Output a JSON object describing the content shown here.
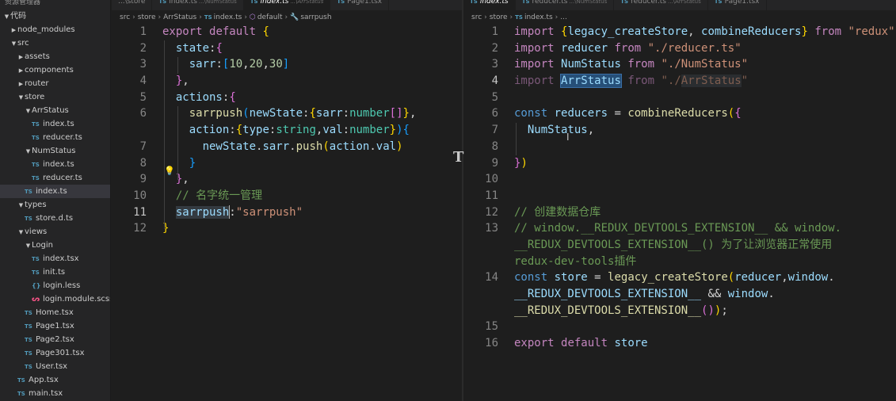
{
  "sidebar": {
    "header": "资源管理器",
    "tree": [
      {
        "label": "代码",
        "depth": 0,
        "kind": "folder-open"
      },
      {
        "label": "node_modules",
        "depth": 1,
        "kind": "folder"
      },
      {
        "label": "src",
        "depth": 1,
        "kind": "folder-open"
      },
      {
        "label": "assets",
        "depth": 2,
        "kind": "folder"
      },
      {
        "label": "components",
        "depth": 2,
        "kind": "folder"
      },
      {
        "label": "router",
        "depth": 2,
        "kind": "folder"
      },
      {
        "label": "store",
        "depth": 2,
        "kind": "folder-open"
      },
      {
        "label": "ArrStatus",
        "depth": 3,
        "kind": "folder-open"
      },
      {
        "label": "index.ts",
        "depth": 4,
        "kind": "ts"
      },
      {
        "label": "reducer.ts",
        "depth": 4,
        "kind": "ts"
      },
      {
        "label": "NumStatus",
        "depth": 3,
        "kind": "folder-open"
      },
      {
        "label": "index.ts",
        "depth": 4,
        "kind": "ts"
      },
      {
        "label": "reducer.ts",
        "depth": 4,
        "kind": "ts"
      },
      {
        "label": "index.ts",
        "depth": 3,
        "kind": "ts",
        "selected": true
      },
      {
        "label": "types",
        "depth": 2,
        "kind": "folder-open"
      },
      {
        "label": "store.d.ts",
        "depth": 3,
        "kind": "dts"
      },
      {
        "label": "views",
        "depth": 2,
        "kind": "folder-open"
      },
      {
        "label": "Login",
        "depth": 3,
        "kind": "folder-open"
      },
      {
        "label": "index.tsx",
        "depth": 4,
        "kind": "tsx"
      },
      {
        "label": "init.ts",
        "depth": 4,
        "kind": "ts"
      },
      {
        "label": "login.less",
        "depth": 4,
        "kind": "less"
      },
      {
        "label": "login.module.scss",
        "depth": 4,
        "kind": "scss"
      },
      {
        "label": "Home.tsx",
        "depth": 3,
        "kind": "tsx"
      },
      {
        "label": "Page1.tsx",
        "depth": 3,
        "kind": "tsx"
      },
      {
        "label": "Page2.tsx",
        "depth": 3,
        "kind": "tsx"
      },
      {
        "label": "Page301.tsx",
        "depth": 3,
        "kind": "tsx"
      },
      {
        "label": "User.tsx",
        "depth": 3,
        "kind": "tsx"
      },
      {
        "label": "App.tsx",
        "depth": 2,
        "kind": "tsx"
      },
      {
        "label": "main.tsx",
        "depth": 2,
        "kind": "tsx"
      }
    ]
  },
  "left_editor": {
    "tabs": [
      {
        "label": "...\\store",
        "desc": ""
      },
      {
        "label": "index.ts",
        "desc": "...\\NumStatus"
      },
      {
        "label": "index.ts",
        "desc": "...\\ArrStatus",
        "active": true
      },
      {
        "label": "Page1.tsx",
        "desc": ""
      }
    ],
    "breadcrumb": [
      "src",
      "store",
      "ArrStatus",
      "index.ts",
      "default",
      "sarrpush"
    ],
    "lines": [
      {
        "n": "1",
        "tokens": [
          [
            "kw",
            "export"
          ],
          [
            "pun",
            " "
          ],
          [
            "kw",
            "default"
          ],
          [
            "pun",
            " "
          ],
          [
            "b1",
            "{"
          ]
        ]
      },
      {
        "n": "2",
        "tokens": [
          [
            "pun",
            "  "
          ],
          [
            "var",
            "state"
          ],
          [
            "pun",
            ":"
          ],
          [
            "b2",
            "{"
          ]
        ]
      },
      {
        "n": "3",
        "tokens": [
          [
            "pun",
            "    "
          ],
          [
            "var",
            "sarr"
          ],
          [
            "pun",
            ":"
          ],
          [
            "b3",
            "["
          ],
          [
            "num",
            "10"
          ],
          [
            "pun",
            ","
          ],
          [
            "num",
            "20"
          ],
          [
            "pun",
            ","
          ],
          [
            "num",
            "30"
          ],
          [
            "b3",
            "]"
          ]
        ]
      },
      {
        "n": "4",
        "tokens": [
          [
            "pun",
            "  "
          ],
          [
            "b2",
            "}"
          ],
          [
            "pun",
            ","
          ]
        ]
      },
      {
        "n": "5",
        "tokens": [
          [
            "pun",
            "  "
          ],
          [
            "var",
            "actions"
          ],
          [
            "pun",
            ":"
          ],
          [
            "b2",
            "{"
          ]
        ]
      },
      {
        "n": "6",
        "tokens": [
          [
            "pun",
            "    "
          ],
          [
            "fn",
            "sarrpush"
          ],
          [
            "b3",
            "("
          ],
          [
            "var",
            "newState"
          ],
          [
            "pun",
            ":"
          ],
          [
            "b1",
            "{"
          ],
          [
            "var",
            "sarr"
          ],
          [
            "pun",
            ":"
          ],
          [
            "type",
            "number"
          ],
          [
            "b2",
            "[]"
          ],
          [
            "b1",
            "}"
          ],
          [
            "pun",
            ","
          ]
        ]
      },
      {
        "n": "",
        "tokens": [
          [
            "pun",
            "    "
          ],
          [
            "var",
            "action"
          ],
          [
            "pun",
            ":"
          ],
          [
            "b1",
            "{"
          ],
          [
            "var",
            "type"
          ],
          [
            "pun",
            ":"
          ],
          [
            "type",
            "string"
          ],
          [
            "pun",
            ","
          ],
          [
            "var",
            "val"
          ],
          [
            "pun",
            ":"
          ],
          [
            "type",
            "number"
          ],
          [
            "b1",
            "}"
          ],
          [
            "b3",
            ")"
          ],
          [
            "b3",
            "{"
          ]
        ]
      },
      {
        "n": "7",
        "tokens": [
          [
            "pun",
            "      "
          ],
          [
            "var",
            "newState"
          ],
          [
            "pun",
            "."
          ],
          [
            "var",
            "sarr"
          ],
          [
            "pun",
            "."
          ],
          [
            "fn",
            "push"
          ],
          [
            "b1",
            "("
          ],
          [
            "var",
            "action"
          ],
          [
            "pun",
            "."
          ],
          [
            "var",
            "val"
          ],
          [
            "b1",
            ")"
          ]
        ]
      },
      {
        "n": "8",
        "tokens": [
          [
            "pun",
            "    "
          ],
          [
            "b3",
            "}"
          ]
        ]
      },
      {
        "n": "9",
        "tokens": [
          [
            "pun",
            "  "
          ],
          [
            "b2",
            "}"
          ],
          [
            "pun",
            ","
          ]
        ]
      },
      {
        "n": "10",
        "tokens": [
          [
            "pun",
            "  "
          ],
          [
            "cmt",
            "// 名字统一管理"
          ]
        ]
      },
      {
        "n": "11",
        "current": true,
        "tokens": [
          [
            "pun",
            "  "
          ],
          [
            "var hl2",
            "sarrpush"
          ],
          [
            "pun",
            ":"
          ],
          [
            "str",
            "\"sarrpush\""
          ]
        ]
      },
      {
        "n": "12",
        "tokens": [
          [
            "b1",
            "}"
          ]
        ]
      }
    ]
  },
  "right_editor": {
    "tabs": [
      {
        "label": "index.ts",
        "desc": "",
        "active": true
      },
      {
        "label": "reducer.ts",
        "desc": "...\\NumStatus"
      },
      {
        "label": "reducer.ts",
        "desc": "...\\ArrStatus"
      },
      {
        "label": "Page1.tsx",
        "desc": ""
      }
    ],
    "breadcrumb": [
      "src",
      "store",
      "index.ts",
      "..."
    ],
    "lines": [
      {
        "n": "1",
        "tokens": [
          [
            "kw",
            "import"
          ],
          [
            "pun",
            " "
          ],
          [
            "b1",
            "{"
          ],
          [
            "var",
            "legacy_createStore"
          ],
          [
            "pun",
            ", "
          ],
          [
            "var",
            "combineReducers"
          ],
          [
            "b1",
            "}"
          ],
          [
            "pun",
            " "
          ],
          [
            "kw",
            "from"
          ],
          [
            "pun",
            " "
          ],
          [
            "str",
            "\"redux\""
          ]
        ]
      },
      {
        "n": "2",
        "tokens": [
          [
            "kw",
            "import"
          ],
          [
            "pun",
            " "
          ],
          [
            "var",
            "reducer"
          ],
          [
            "pun",
            " "
          ],
          [
            "kw",
            "from"
          ],
          [
            "pun",
            " "
          ],
          [
            "str",
            "\"./reducer.ts\""
          ]
        ]
      },
      {
        "n": "3",
        "tokens": [
          [
            "kw",
            "import"
          ],
          [
            "pun",
            " "
          ],
          [
            "var",
            "NumStatus"
          ],
          [
            "pun",
            " "
          ],
          [
            "kw",
            "from"
          ],
          [
            "pun",
            " "
          ],
          [
            "str",
            "\"./NumStatus\""
          ]
        ]
      },
      {
        "n": "4",
        "current": true,
        "tokens": [
          [
            "kw dim",
            "import"
          ],
          [
            "pun",
            " "
          ],
          [
            "var hlsel",
            "ArrStatus"
          ],
          [
            "pun",
            " "
          ],
          [
            "kw dim",
            "from"
          ],
          [
            "pun",
            " "
          ],
          [
            "str dim",
            "\"./"
          ],
          [
            "str dim hl2",
            "ArrStatus"
          ],
          [
            "str dim",
            "\""
          ]
        ]
      },
      {
        "n": "5",
        "tokens": []
      },
      {
        "n": "6",
        "tokens": [
          [
            "kw2",
            "const"
          ],
          [
            "pun",
            " "
          ],
          [
            "var",
            "reducers"
          ],
          [
            "pun",
            " = "
          ],
          [
            "fn",
            "combineReducers"
          ],
          [
            "b1",
            "("
          ],
          [
            "b2",
            "{"
          ]
        ]
      },
      {
        "n": "7",
        "tokens": [
          [
            "pun",
            "  "
          ],
          [
            "var",
            "NumStatus"
          ],
          [
            "pun",
            ","
          ]
        ]
      },
      {
        "n": "8",
        "tokens": []
      },
      {
        "n": "9",
        "tokens": [
          [
            "b2",
            "}"
          ],
          [
            "b1",
            ")"
          ]
        ]
      },
      {
        "n": "10",
        "tokens": []
      },
      {
        "n": "11",
        "tokens": []
      },
      {
        "n": "12",
        "tokens": [
          [
            "cmt",
            "// 创建数据仓库"
          ]
        ]
      },
      {
        "n": "13",
        "tokens": [
          [
            "cmt",
            "// window.__REDUX_DEVTOOLS_EXTENSION__ && window."
          ]
        ]
      },
      {
        "n": "",
        "tokens": [
          [
            "cmt",
            "__REDUX_DEVTOOLS_EXTENSION__() 为了让浏览器正常使用"
          ]
        ]
      },
      {
        "n": "",
        "tokens": [
          [
            "cmt",
            "redux-dev-tools插件"
          ]
        ]
      },
      {
        "n": "14",
        "tokens": [
          [
            "kw2",
            "const"
          ],
          [
            "pun",
            " "
          ],
          [
            "var",
            "store"
          ],
          [
            "pun",
            " = "
          ],
          [
            "fn",
            "legacy_createStore"
          ],
          [
            "b1",
            "("
          ],
          [
            "var",
            "reducer"
          ],
          [
            "pun",
            ","
          ],
          [
            "var",
            "window"
          ],
          [
            "pun",
            "."
          ]
        ]
      },
      {
        "n": "",
        "tokens": [
          [
            "var",
            "__REDUX_DEVTOOLS_EXTENSION__"
          ],
          [
            "pun",
            " && "
          ],
          [
            "var",
            "window"
          ],
          [
            "pun",
            "."
          ]
        ]
      },
      {
        "n": "",
        "tokens": [
          [
            "fn",
            "__REDUX_DEVTOOLS_EXTENSION__"
          ],
          [
            "b2",
            "()"
          ],
          [
            "b1",
            ")"
          ],
          [
            "pun",
            ";"
          ]
        ]
      },
      {
        "n": "15",
        "tokens": []
      },
      {
        "n": "16",
        "tokens": [
          [
            "kw",
            "export"
          ],
          [
            "pun",
            " "
          ],
          [
            "kw",
            "default"
          ],
          [
            "pun",
            " "
          ],
          [
            "var",
            "store"
          ]
        ]
      }
    ]
  }
}
